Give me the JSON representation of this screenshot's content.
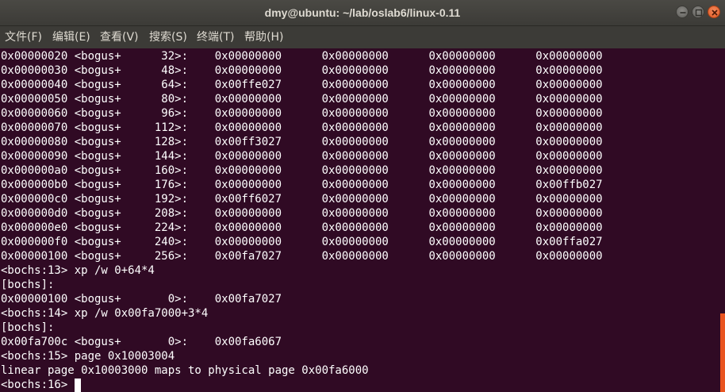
{
  "window": {
    "title": "dmy@ubuntu: ~/lab/oslab6/linux-0.11"
  },
  "menu": [
    {
      "label": "文件(F)"
    },
    {
      "label": "编辑(E)"
    },
    {
      "label": "查看(V)"
    },
    {
      "label": "搜索(S)"
    },
    {
      "label": "终端(T)"
    },
    {
      "label": "帮助(H)"
    }
  ],
  "terminal": {
    "lines": [
      "0x00000020 <bogus+      32>:    0x00000000      0x00000000      0x00000000      0x00000000",
      "0x00000030 <bogus+      48>:    0x00000000      0x00000000      0x00000000      0x00000000",
      "0x00000040 <bogus+      64>:    0x00ffe027      0x00000000      0x00000000      0x00000000",
      "0x00000050 <bogus+      80>:    0x00000000      0x00000000      0x00000000      0x00000000",
      "0x00000060 <bogus+      96>:    0x00000000      0x00000000      0x00000000      0x00000000",
      "0x00000070 <bogus+     112>:    0x00000000      0x00000000      0x00000000      0x00000000",
      "0x00000080 <bogus+     128>:    0x00ff3027      0x00000000      0x00000000      0x00000000",
      "0x00000090 <bogus+     144>:    0x00000000      0x00000000      0x00000000      0x00000000",
      "0x000000a0 <bogus+     160>:    0x00000000      0x00000000      0x00000000      0x00000000",
      "0x000000b0 <bogus+     176>:    0x00000000      0x00000000      0x00000000      0x00ffb027",
      "0x000000c0 <bogus+     192>:    0x00ff6027      0x00000000      0x00000000      0x00000000",
      "0x000000d0 <bogus+     208>:    0x00000000      0x00000000      0x00000000      0x00000000",
      "0x000000e0 <bogus+     224>:    0x00000000      0x00000000      0x00000000      0x00000000",
      "0x000000f0 <bogus+     240>:    0x00000000      0x00000000      0x00000000      0x00ffa027",
      "0x00000100 <bogus+     256>:    0x00fa7027      0x00000000      0x00000000      0x00000000",
      "<bochs:13> xp /w 0+64*4",
      "[bochs]:",
      "0x00000100 <bogus+       0>:    0x00fa7027",
      "<bochs:14> xp /w 0x00fa7000+3*4",
      "[bochs]:",
      "0x00fa700c <bogus+       0>:    0x00fa6067",
      "<bochs:15> page 0x10003004",
      "linear page 0x10003000 maps to physical page 0x00fa6000"
    ],
    "prompt": "<bochs:16> "
  },
  "colors": {
    "terminal_bg": "#300a24",
    "terminal_fg": "#ffffff",
    "titlebar_bg": "#3c3b37",
    "close_button": "#e05a22",
    "scrollbar_thumb": "#e95420"
  },
  "icons": {
    "minimize": "minimize-icon",
    "maximize": "maximize-icon",
    "close": "close-icon"
  }
}
